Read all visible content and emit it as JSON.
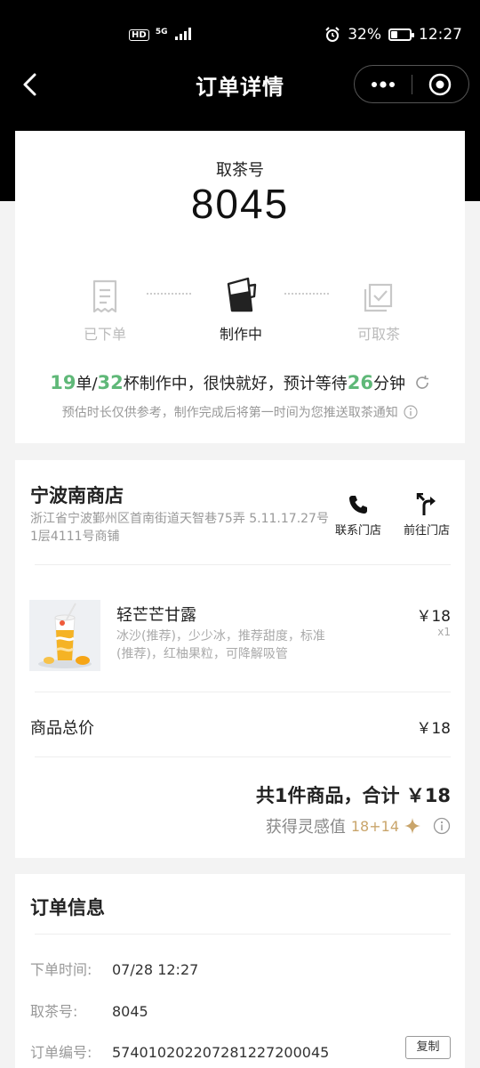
{
  "status_bar": {
    "network": "HD",
    "network_type": "5G",
    "battery": "32%",
    "battery_level": 0.32,
    "time": "12:27"
  },
  "nav": {
    "title": "订单详情"
  },
  "pickup": {
    "label": "取茶号",
    "number": "8045",
    "steps": [
      {
        "label": "已下单",
        "state": "done"
      },
      {
        "label": "制作中",
        "state": "active"
      },
      {
        "label": "可取茶",
        "state": "pending"
      }
    ],
    "progress": {
      "orders": "19",
      "unit_orders": "单/",
      "cups": "32",
      "mid_text": "杯制作中，很快就好，预计等待",
      "minutes": "26",
      "unit_minutes": "分钟"
    },
    "note": "预估时长仅供参考，制作完成后将第一时间为您推送取茶通知"
  },
  "store": {
    "name": "宁波南商店",
    "address": "浙江省宁波鄞州区首南街道天智巷75弄 5.11.17.27号1层4111号商铺",
    "contact_label": "联系门店",
    "navigate_label": "前往门店"
  },
  "product": {
    "name": "轻芒芒甘露",
    "desc": "冰沙(推荐)，少少冰，推荐甜度，标准(推荐)，红柚果粒，可降解吸管",
    "price": "￥18",
    "qty": "x1"
  },
  "summary": {
    "subtotal_label": "商品总价",
    "subtotal_value": "￥18",
    "total_text": "共1件商品，合计 ￥18",
    "points_label": "获得灵感值",
    "points_value": "18+14"
  },
  "order_info": {
    "title": "订单信息",
    "rows": [
      {
        "key": "下单时间:",
        "value": "07/28 12:27"
      },
      {
        "key": "取茶号:",
        "value": "8045"
      },
      {
        "key": "订单编号:",
        "value": "5740102022072812272000​45"
      }
    ],
    "copy_label": "复制"
  },
  "colors": {
    "accent_green": "#5fb878",
    "gold": "#c9a56b"
  }
}
